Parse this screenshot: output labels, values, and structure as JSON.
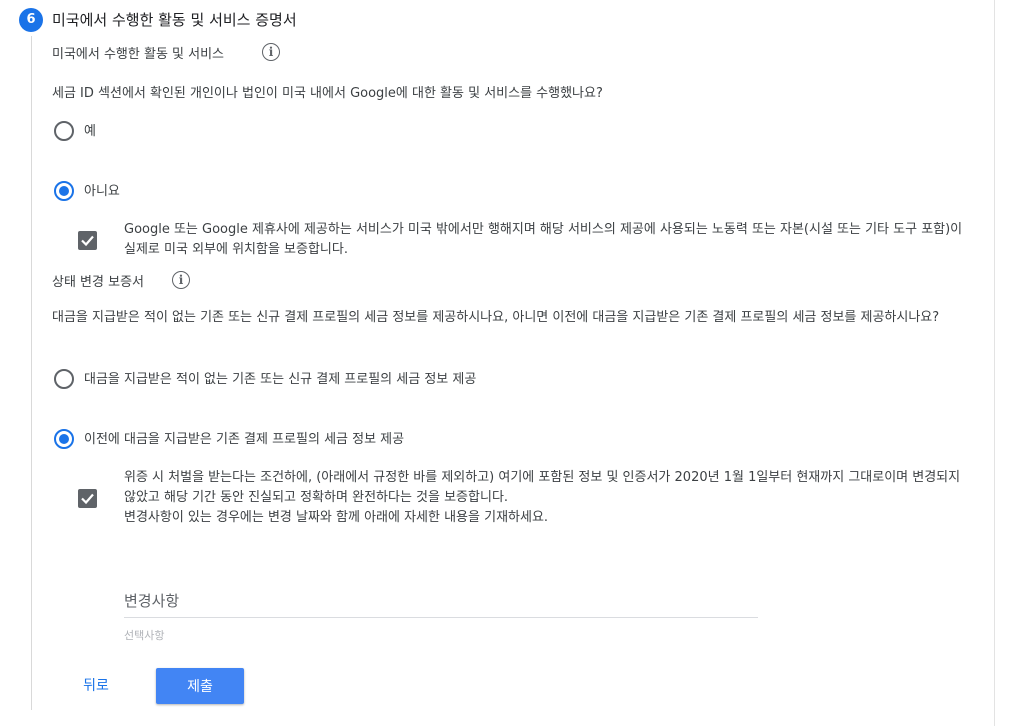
{
  "section": {
    "step_number": "6",
    "title": "미국에서 수행한 활동 및 서비스 증명서"
  },
  "activities": {
    "heading": "미국에서 수행한 활동 및 서비스",
    "question": "세금 ID 섹션에서 확인된 개인이나 법인이 미국 내에서 Google에 대한 활동 및 서비스를 수행했나요?",
    "options": [
      {
        "label": "예",
        "selected": false
      },
      {
        "label": "아니요",
        "selected": true
      }
    ],
    "certification": {
      "checked": true,
      "text": "Google 또는 Google 제휴사에 제공하는 서비스가 미국 밖에서만 행해지며 해당 서비스의 제공에 사용되는 노동력 또는 자본(시설 또는 기타 도구 포함)이 실제로 미국 외부에 위치함을 보증합니다."
    }
  },
  "status_change": {
    "heading": "상태 변경 보증서",
    "question": "대금을 지급받은 적이 없는 기존 또는 신규 결제 프로필의 세금 정보를 제공하시나요, 아니면 이전에 대금을 지급받은 기존 결제 프로필의 세금 정보를 제공하시나요?",
    "options": [
      {
        "label": "대금을 지급받은 적이 없는 기존 또는 신규 결제 프로필의 세금 정보 제공",
        "selected": false
      },
      {
        "label": "이전에 대금을 지급받은 기존 결제 프로필의 세금 정보 제공",
        "selected": true
      }
    ],
    "certification": {
      "checked": true,
      "text": "위증 시 처벌을 받는다는 조건하에, (아래에서 규정한 바를 제외하고) 여기에 포함된 정보 및 인증서가 2020년 1월 1일부터 현재까지 그대로이며 변경되지 않았고 해당 기간 동안 진실되고 정확하며 완전하다는 것을 보증합니다.",
      "note": "변경사항이 있는 경우에는 변경 날짜와 함께 아래에 자세한 내용을 기재하세요."
    },
    "changes_field": {
      "placeholder": "변경사항",
      "value": "",
      "hint": "선택사항"
    }
  },
  "actions": {
    "back_label": "뒤로",
    "submit_label": "제출"
  },
  "icons": {
    "info": "info-icon",
    "check": "check-icon"
  },
  "colors": {
    "accent": "#1a73e8",
    "button": "#4285f4",
    "checkbox": "#5f6368"
  }
}
